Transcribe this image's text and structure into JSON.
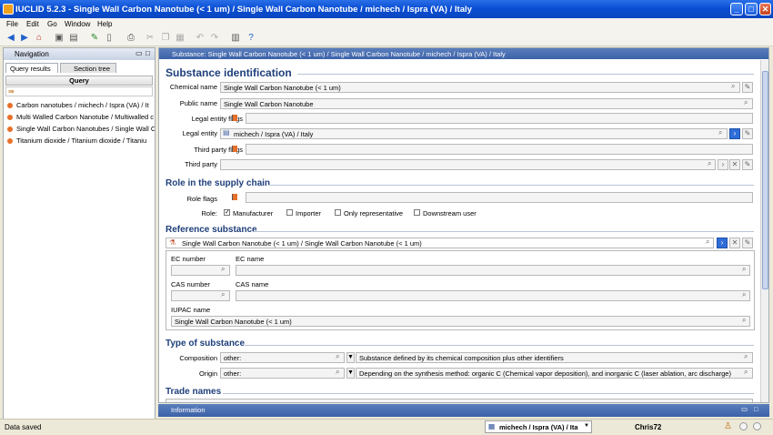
{
  "window": {
    "title": "IUCLID 5.2.3 - Single Wall Carbon Nanotube (< 1 um) / Single Wall Carbon Nanotube / michech / Ispra (VA) / Italy"
  },
  "menu": [
    "File",
    "Edit",
    "Go",
    "Window",
    "Help"
  ],
  "nav": {
    "title": "Navigation",
    "tabs": [
      "Query results",
      "Section tree"
    ],
    "query_header": "Query",
    "items": [
      "Carbon nanotubes / michech / Ispra (VA) / It",
      "Multi Walled Carbon Nanotube / Multiwalled c",
      "Single Wall Carbon Nanotubes / Single Wall C",
      "Titanium dioxide / Titanium dioxide / Titaniu"
    ]
  },
  "doc": {
    "header": "Substance: Single Wall Carbon Nanotube (< 1 um) / Single Wall Carbon Nanotube / michech / Ispra (VA) / Italy",
    "sections": {
      "identification": "Substance identification",
      "role": "Role in the supply chain",
      "reference": "Reference substance",
      "type": "Type of substance",
      "trade": "Trade names"
    },
    "labels": {
      "chemical_name": "Chemical name",
      "public_name": "Public name",
      "legal_entity_flags": "Legal entity flags",
      "legal_entity": "Legal entity",
      "third_party_flags": "Third party flags",
      "third_party": "Third party",
      "role_flags": "Role flags",
      "role": "Role:",
      "ec_number": "EC number",
      "ec_name": "EC name",
      "cas_number": "CAS number",
      "cas_name": "CAS name",
      "iupac_name": "IUPAC name",
      "composition": "Composition",
      "origin": "Origin"
    },
    "values": {
      "chemical_name": "Single Wall Carbon Nanotube (< 1 um)",
      "public_name": "Single Wall Carbon Nanotube",
      "legal_entity": "michech / Ispra (VA) / Italy",
      "third_party": "",
      "reference_substance": "Single Wall Carbon Nanotube (< 1 um) / Single Wall Carbon Nanotube (< 1 um)",
      "ec_number": "",
      "ec_name": "",
      "cas_number": "",
      "cas_name": "",
      "iupac_name": "Single Wall Carbon Nanotube (< 1 um)",
      "composition": "other:",
      "composition_text": "Substance defined by its chemical composition plus other identifiers",
      "origin": "other:",
      "origin_text": "Depending on the synthesis method: organic C (Chemical vapor deposition), and inorganic C (laser ablation, arc discharge)"
    },
    "roles": [
      {
        "label": "Manufacturer",
        "checked": true
      },
      {
        "label": "Importer",
        "checked": false
      },
      {
        "label": "Only representative",
        "checked": false
      },
      {
        "label": "Downstream user",
        "checked": false
      }
    ]
  },
  "info": {
    "title": "Information"
  },
  "status": {
    "text": "Data saved",
    "legal_entity": "michech / Ispra (VA) / Ita",
    "user": "Chris72"
  },
  "colors": {
    "title_bar": "#0b4fd4",
    "section": "#1f3f7a",
    "flag": "#e8702a",
    "accent_button": "#2f6ed8"
  }
}
